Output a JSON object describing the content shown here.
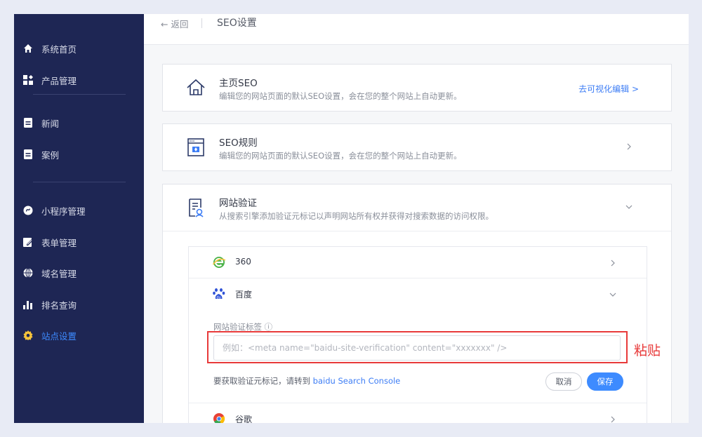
{
  "sidebar": {
    "items": [
      {
        "label": "系统首页",
        "icon": "home-icon"
      },
      {
        "label": "产品管理",
        "icon": "product-grid-icon"
      },
      {
        "label": "新闻",
        "icon": "document-icon"
      },
      {
        "label": "案例",
        "icon": "document-icon"
      },
      {
        "label": "小程序管理",
        "icon": "mini-program-icon"
      },
      {
        "label": "表单管理",
        "icon": "form-edit-icon"
      },
      {
        "label": "域名管理",
        "icon": "globe-icon"
      },
      {
        "label": "排名查询",
        "icon": "bar-chart-icon"
      },
      {
        "label": "站点设置",
        "icon": "gear-icon"
      }
    ],
    "active_item": "站点设置",
    "active_color": "#3d8bff"
  },
  "header": {
    "back_label": "← 返回",
    "title": "SEO设置"
  },
  "cards": {
    "home_seo": {
      "title": "主页SEO",
      "desc": "编辑您的网站页面的默认SEO设置，会在您的整个网站上自动更新。",
      "link": "去可视化编辑 >"
    },
    "seo_rules": {
      "title": "SEO规则",
      "desc": "编辑您的网站页面的默认SEO设置，会在您的整个网站上自动更新。"
    },
    "site_verify": {
      "title": "网站验证",
      "desc": "从搜索引擎添加验证元标记以声明网站所有权并获得对搜索数据的访问权限。"
    }
  },
  "engines": {
    "e360": {
      "label": "360",
      "icon": "360-browser-icon"
    },
    "baidu": {
      "label": "百度",
      "icon": "baidu-paw-icon"
    },
    "google": {
      "label": "谷歌",
      "icon": "chrome-icon"
    }
  },
  "baidu_form": {
    "field_label": "网站验证标签 ⓘ",
    "placeholder": "例如：<meta name=\"baidu-site-verification\" content=\"xxxxxxx\" />",
    "value": "",
    "hint_prefix": "要获取验证元标记，请转到 ",
    "hint_link": "baidu Search Console",
    "cancel_label": "取消",
    "save_label": "保存"
  },
  "annotation": {
    "label": "粘贴",
    "color": "#e83a3a"
  }
}
